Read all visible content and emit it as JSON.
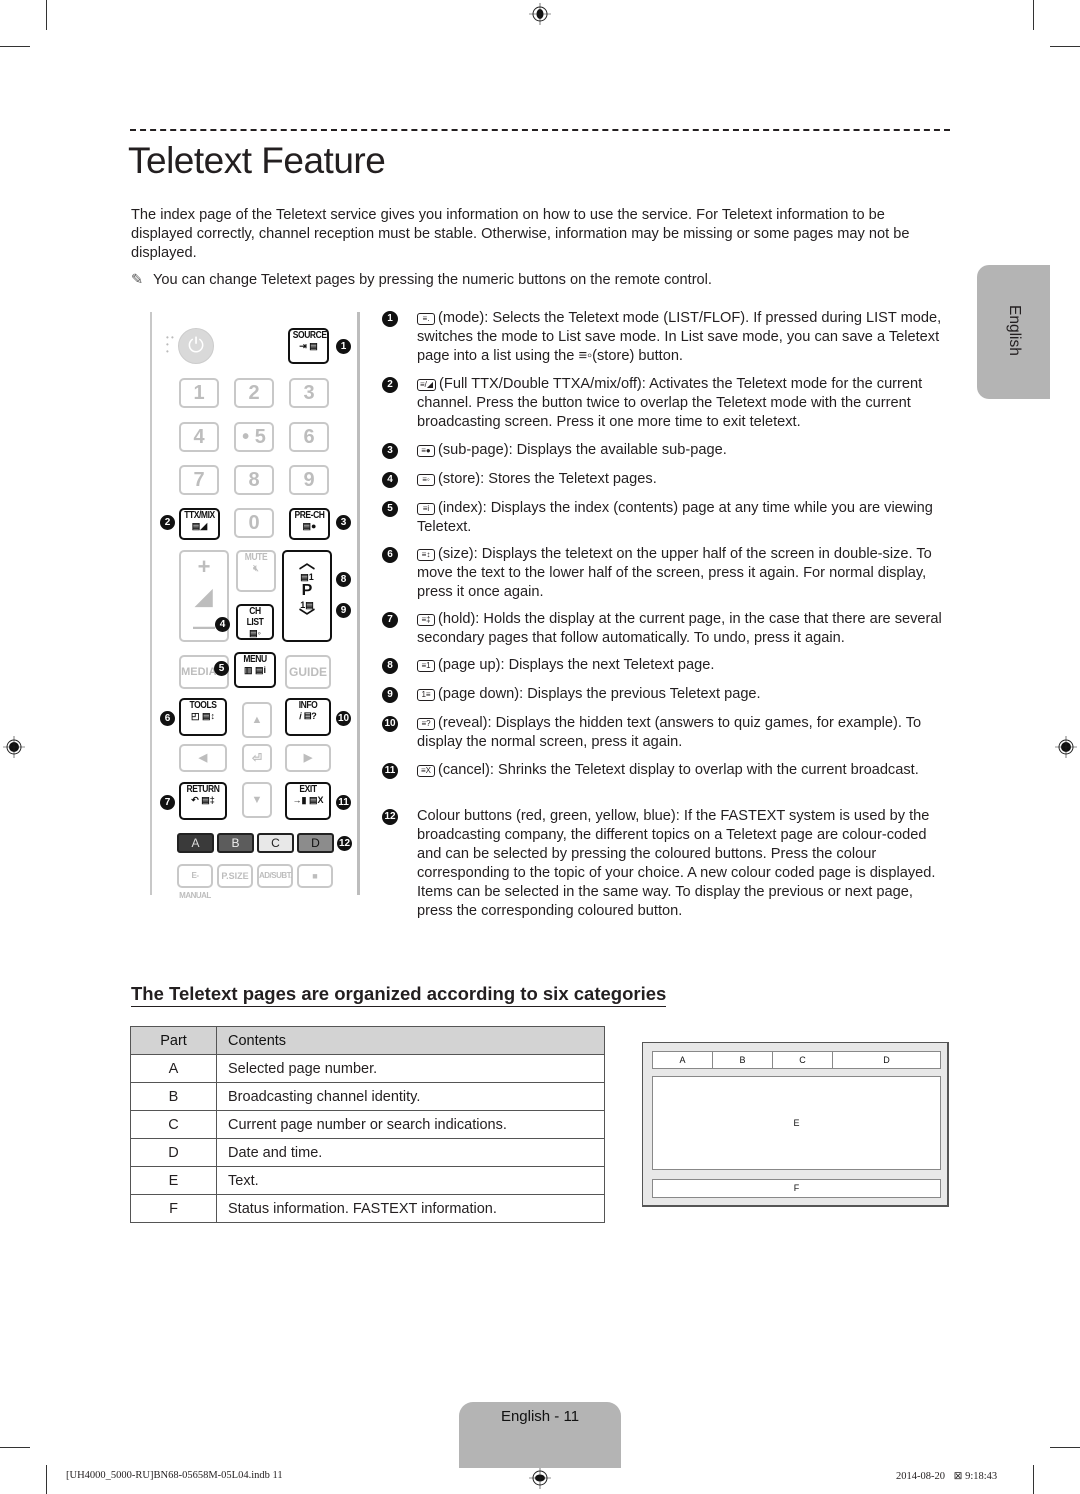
{
  "page": {
    "title": "Teletext Feature",
    "intro": "The index page of the Teletext service gives you information on how to use the service. For Teletext information to be displayed correctly, channel reception must be stable. Otherwise, information may be missing or some pages may not be displayed.",
    "note_icon": "pencil-note-icon",
    "note": "You can change Teletext pages by pressing the numeric buttons on the remote control.",
    "language_tab": "English"
  },
  "remote": {
    "source": "SOURCE",
    "numbers": [
      "1",
      "2",
      "3",
      "4",
      "• 5",
      "6",
      "7",
      "8",
      "9",
      "0"
    ],
    "ttx_mix": "TTX/MIX",
    "pre_ch": "PRE-CH",
    "mute": "MUTE",
    "ch_list": "CH LIST",
    "p": "P",
    "media": "MEDIA.P",
    "menu": "MENU",
    "guide": "GUIDE",
    "tools": "TOOLS",
    "info": "INFO",
    "return": "RETURN",
    "exit": "EXIT",
    "color_buttons": [
      {
        "label": "A",
        "color": "#3a3a3a",
        "text": "#ddd"
      },
      {
        "label": "B",
        "color": "#5c5c5c",
        "text": "#eee"
      },
      {
        "label": "C",
        "color": "#e8e8e8",
        "text": "#222"
      },
      {
        "label": "D",
        "color": "#8c8c8c",
        "text": "#111"
      }
    ],
    "bottom": [
      "E-MANUAL",
      "P.SIZE",
      "AD/SUBT.",
      "■"
    ],
    "callouts": [
      "1",
      "2",
      "3",
      "4",
      "5",
      "6",
      "7",
      "8",
      "9",
      "10",
      "11",
      "12"
    ]
  },
  "items": [
    {
      "n": "1",
      "glyph": "≡.",
      "text": "(mode): Selects the Teletext mode (LIST/FLOF). If pressed during LIST mode, switches the mode to List save mode. In List save mode, you can save a Teletext page into a list using the ≡◦(store) button."
    },
    {
      "n": "2",
      "glyph": "≡/◢",
      "text": "(Full TTX/Double TTXA/mix/off): Activates the Teletext mode for the current channel. Press the button twice to overlap the Teletext mode with the current broadcasting screen. Press it one more time to exit teletext."
    },
    {
      "n": "3",
      "glyph": "≡●",
      "text": "(sub-page): Displays the available sub-page."
    },
    {
      "n": "4",
      "glyph": "≡◦",
      "text": "(store): Stores the Teletext pages."
    },
    {
      "n": "5",
      "glyph": "≡i",
      "text": "(index): Displays the index (contents) page at any time while you are viewing Teletext."
    },
    {
      "n": "6",
      "glyph": "≡↕",
      "text": "(size): Displays the teletext on the upper half of the screen in double-size. To move the text to the lower half of the screen, press it again. For normal display, press it once again."
    },
    {
      "n": "7",
      "glyph": "≡‡",
      "text": "(hold): Holds the display at the current page, in the case that there are several secondary pages that follow automatically. To undo, press it again."
    },
    {
      "n": "8",
      "glyph": "≡1",
      "text": "(page up): Displays the next Teletext page."
    },
    {
      "n": "9",
      "glyph": "1≡",
      "text": "(page down): Displays the previous Teletext page."
    },
    {
      "n": "10",
      "glyph": "≡?",
      "text": "(reveal): Displays the hidden text (answers to quiz games, for example). To display the normal screen, press it again."
    },
    {
      "n": "11",
      "glyph": "≡X",
      "text": "(cancel): Shrinks the Teletext display to overlap with the current broadcast."
    },
    {
      "n": "12",
      "glyph": "",
      "text": "Colour buttons (red, green, yellow, blue): If the FASTEXT system is used by the broadcasting company, the different topics on a Teletext page are colour-coded and can be selected by pressing the coloured buttons. Press the colour corresponding to the topic of your choice. A new colour coded page is displayed. Items can be selected in the same way. To display the previous or next page, press the corresponding coloured button."
    }
  ],
  "section": {
    "heading": "The Teletext pages are organized according to six categories",
    "table": {
      "headers": [
        "Part",
        "Contents"
      ],
      "rows": [
        [
          "A",
          "Selected page number."
        ],
        [
          "B",
          "Broadcasting channel identity."
        ],
        [
          "C",
          "Current page number or search indications."
        ],
        [
          "D",
          "Date and time."
        ],
        [
          "E",
          "Text."
        ],
        [
          "F",
          "Status information. FASTEXT information."
        ]
      ]
    },
    "diagram": {
      "a": "A",
      "b": "B",
      "c": "C",
      "d": "D",
      "e": "E",
      "f": "F"
    }
  },
  "footer": {
    "page_label": "English - 11",
    "file": "[UH4000_5000-RU]BN68-05658M-05L04.indb   11",
    "date": "2014-08-20",
    "time_icon": "⊠",
    "time": "9:18:43"
  }
}
